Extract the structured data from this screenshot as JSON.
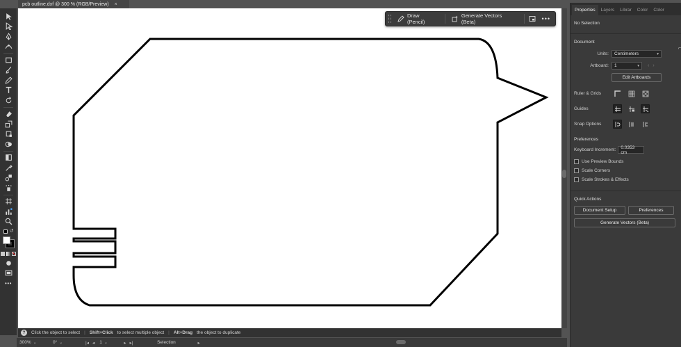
{
  "document": {
    "tab_title": "pcb outline.dxf @ 300 % (RGB/Preview)",
    "close_label": "×"
  },
  "tools": [
    {
      "name": "selection-tool-icon"
    },
    {
      "name": "direct-selection-tool-icon"
    },
    {
      "name": "pen-tool-icon"
    },
    {
      "name": "curvature-tool-icon"
    },
    {
      "name": "rectangle-tool-icon"
    },
    {
      "name": "paintbrush-tool-icon"
    },
    {
      "name": "pencil-tool-icon"
    },
    {
      "name": "type-tool-icon"
    },
    {
      "name": "rotate-tool-icon"
    },
    {
      "name": "eraser-tool-icon"
    },
    {
      "name": "scale-tool-icon"
    },
    {
      "name": "free-transform-tool-icon"
    },
    {
      "name": "shape-builder-tool-icon"
    },
    {
      "name": "gradient-tool-icon"
    },
    {
      "name": "eyedropper-tool-icon"
    },
    {
      "name": "blend-tool-icon"
    },
    {
      "name": "symbol-sprayer-tool-icon"
    },
    {
      "name": "artboard-tool-icon"
    },
    {
      "name": "bar-graph-tool-icon"
    },
    {
      "name": "zoom-tool-icon"
    }
  ],
  "taskbar": {
    "draw_label": "Draw (Pencil)",
    "generate_label": "Generate Vectors (Beta)",
    "more_label": "•••"
  },
  "status": {
    "hint1": "Click the object to select",
    "hint2_key": "Shift+Click",
    "hint2": "to select multiple object",
    "hint3_key": "Alt+Drag",
    "hint3": "the object to duplicate",
    "separator": "|"
  },
  "bottom": {
    "zoom": "300%",
    "rotation": "0°",
    "artboard_num": "1",
    "tool_name": "Selection",
    "nav_first": "|◂",
    "nav_prev": "◂",
    "nav_next": "▸",
    "nav_last": "▸|",
    "play": "▸"
  },
  "panel": {
    "tabs": [
      "Properties",
      "Layers",
      "Librar",
      "Color",
      "Color"
    ],
    "selection_state": "No Selection",
    "document_section": "Document",
    "units_label": "Units:",
    "units_value": "Centimeters",
    "artboard_label": "Artboard:",
    "artboard_value": "1",
    "edit_artboards": "Edit Artboards",
    "rulers_label": "Ruler & Grids",
    "guides_label": "Guides",
    "snap_label": "Snap Options",
    "preferences_section": "Preferences",
    "keyboard_increment_label": "Keyboard Increment:",
    "keyboard_increment_value": "0.0353 cm",
    "use_preview_bounds": "Use Preview Bounds",
    "scale_corners": "Scale Corners",
    "scale_strokes": "Scale Strokes & Effects",
    "quick_actions_section": "Quick Actions",
    "document_setup": "Document Setup",
    "preferences_btn": "Preferences",
    "generate_vectors": "Generate Vectors (Beta)"
  },
  "colors": {
    "panel_bg": "#3a3a3a",
    "canvas_bg": "#535353",
    "artboard": "#ffffff",
    "outline": "#000000"
  }
}
